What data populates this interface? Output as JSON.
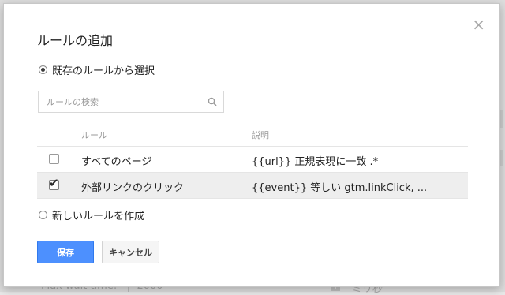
{
  "background": {
    "max_wait_label": "Max wait time:",
    "max_wait_value": "2000",
    "side_text": "ミリ秒",
    "plus_icon": "plus-icon"
  },
  "dialog": {
    "title": "ルールの追加",
    "close_icon": "×",
    "option_existing_label": "既存のルールから選択",
    "option_new_label": "新しいルールを作成",
    "selected_option": "existing",
    "search": {
      "placeholder": "ルールの検索",
      "value": ""
    },
    "table": {
      "columns": [
        "ルール",
        "説明"
      ],
      "rows": [
        {
          "name": "すべてのページ",
          "description": "{{url}} 正規表現に一致 .*",
          "checked": false
        },
        {
          "name": "外部リンクのクリック",
          "description": "{{event}} 等しい gtm.linkClick, ...",
          "checked": true
        }
      ]
    },
    "buttons": {
      "save_label": "保存",
      "cancel_label": "キャンセル"
    }
  },
  "colors": {
    "primary_button": "#4d90fe",
    "selected_row": "#eeeeee"
  }
}
